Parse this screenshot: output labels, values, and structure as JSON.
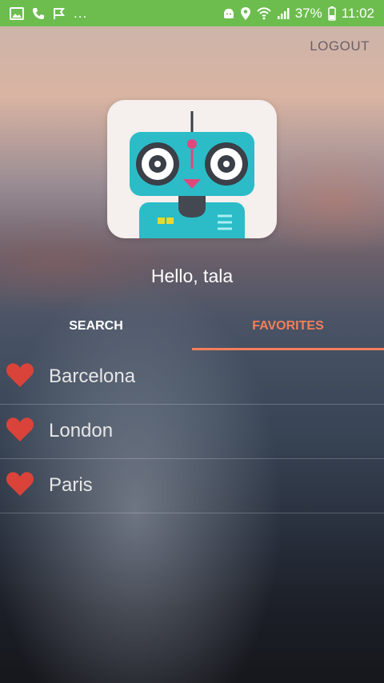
{
  "status_bar": {
    "left_more": "...",
    "battery_percent": "37%",
    "time": "11:02",
    "background_color": "#6cbd4e"
  },
  "header": {
    "logout_label": "LOGOUT"
  },
  "greeting": "Hello, tala",
  "tabs": [
    {
      "label": "SEARCH",
      "selected": false
    },
    {
      "label": "FAVORITES",
      "selected": true
    }
  ],
  "accent_color": "#f47f5a",
  "favorites": [
    {
      "city": "Barcelona",
      "icon": "heart-icon"
    },
    {
      "city": "London",
      "icon": "heart-icon"
    },
    {
      "city": "Paris",
      "icon": "heart-icon"
    }
  ]
}
